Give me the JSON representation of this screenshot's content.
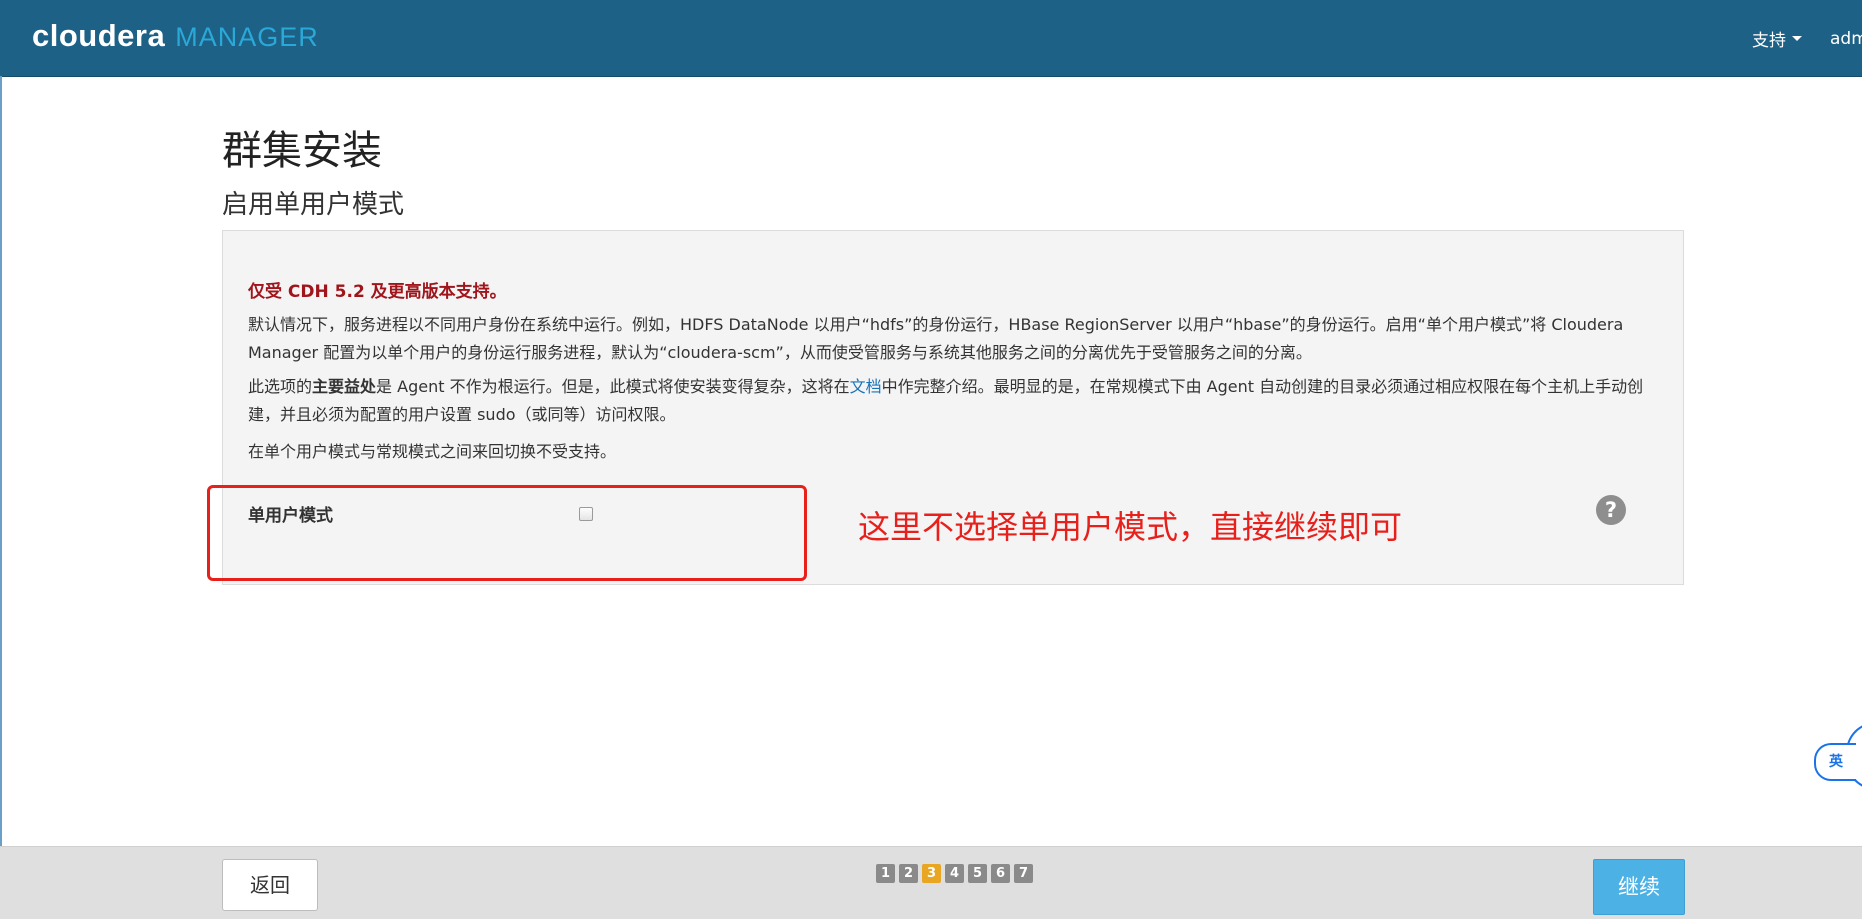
{
  "header": {
    "brand_main": "cloudera",
    "brand_sub": "MANAGER",
    "support_label": "支持",
    "user_label": "adm"
  },
  "page": {
    "title": "群集安装",
    "subtitle": "启用单用户模式"
  },
  "panel": {
    "notice": "仅受 CDH 5.2 及更高版本支持。",
    "p1": "默认情况下，服务进程以不同用户身份在系统中运行。例如，HDFS DataNode 以用户“hdfs”的身份运行，HBase RegionServer 以用户“hbase”的身份运行。启用“单个用户模式”将 Cloudera Manager 配置为以单个用户的身份运行服务进程，默认为“cloudera-scm”，从而使受管服务与系统其他服务之间的分离优先于受管服务之间的分离。",
    "p2_pre": "此选项的",
    "p2_bold": "主要益处",
    "p2_mid": "是 Agent 不作为根运行。但是，此模式将使安装变得复杂，这将在",
    "p2_link": "文档",
    "p2_post": "中作完整介绍。最明显的是，在常规模式下由 Agent 自动创建的目录必须通过相应权限在每个主机上手动创建，并且必须为配置的用户设置 sudo（或同等）访问权限。",
    "p3": "在单个用户模式与常规模式之间来回切换不受支持。",
    "field_label": "单用户模式",
    "checkbox_checked": false,
    "help_icon": "question-circle-icon"
  },
  "annotation": {
    "text": "这里不选择单用户模式，直接继续即可",
    "color": "#e8201c"
  },
  "lang_bubble": "英",
  "footer": {
    "back_label": "返回",
    "next_label": "继续",
    "pages": [
      "1",
      "2",
      "3",
      "4",
      "5",
      "6",
      "7"
    ],
    "current_page": 3
  },
  "colors": {
    "navbar": "#1d6186",
    "brand_accent": "#2aa8d8",
    "notice": "#a0141b",
    "next_button": "#4cb2e6",
    "active_page": "#e8a623"
  }
}
